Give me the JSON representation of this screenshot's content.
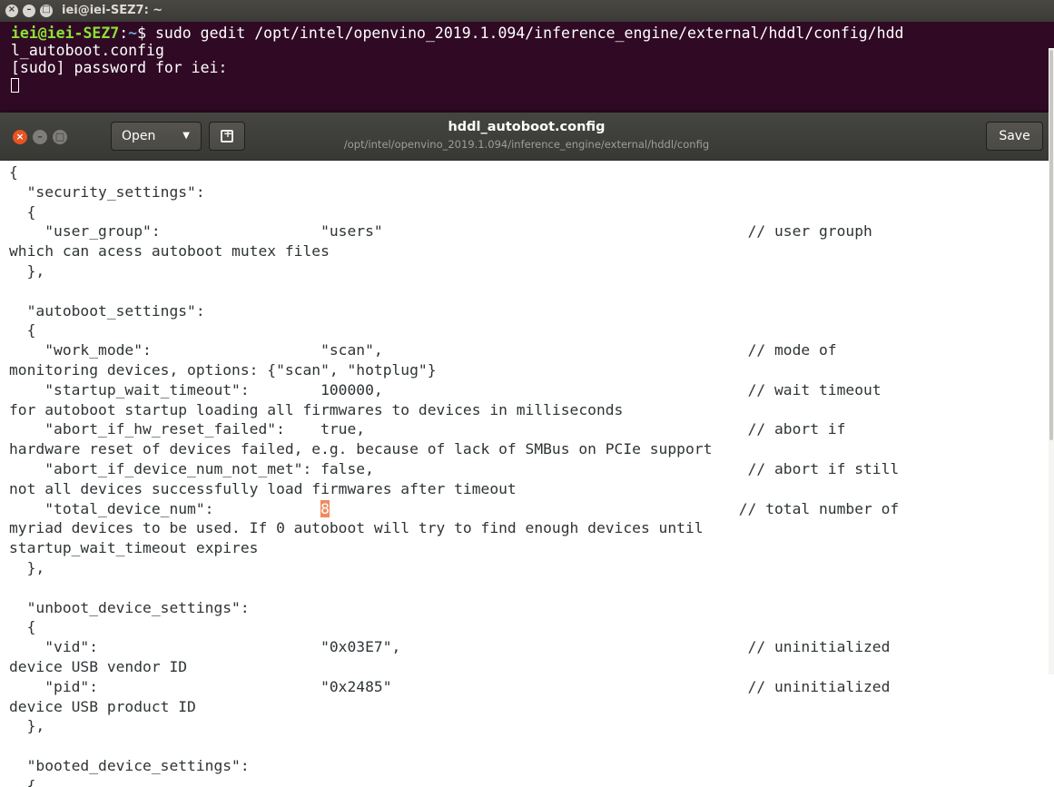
{
  "terminal": {
    "title": "iei@iei-SEZ7: ~",
    "prompt_user": "iei@iei-SEZ7",
    "prompt_sep": ":",
    "prompt_path": "~",
    "prompt_symbol": "$",
    "command_line1": " sudo gedit /opt/intel/openvino_2019.1.094/inference_engine/external/hddl/config/hdd",
    "command_line2": "l_autoboot.config",
    "sudo_prompt": "[sudo] password for iei:"
  },
  "gedit": {
    "open_label": "Open",
    "title": "hddl_autoboot.config",
    "subtitle": "/opt/intel/openvino_2019.1.094/inference_engine/external/hddl/config",
    "save_label": "Save",
    "lines": [
      "{",
      "  \"security_settings\":",
      "  {",
      "    \"user_group\":                  \"users\"                                         // user grouph",
      "which can acess autoboot mutex files",
      "  },",
      "",
      "  \"autoboot_settings\":",
      "  {",
      "    \"work_mode\":                   \"scan\",                                         // mode of",
      "monitoring devices, options: {\"scan\", \"hotplug\"}",
      "    \"startup_wait_timeout\":        100000,                                         // wait timeout",
      "for autoboot startup loading all firmwares to devices in milliseconds",
      "    \"abort_if_hw_reset_failed\":    true,                                           // abort if",
      "hardware reset of devices failed, e.g. because of lack of SMBus on PCIe support",
      "    \"abort_if_device_num_not_met\": false,                                          // abort if still",
      "not all devices successfully load firmwares after timeout",
      "    \"total_device_num\":            ",
      "myriad devices to be used. If 0 autoboot will try to find enough devices until",
      "startup_wait_timeout expires",
      "  },",
      "",
      "  \"unboot_device_settings\":",
      "  {",
      "    \"vid\":                         \"0x03E7\",                                       // uninitialized",
      "device USB vendor ID",
      "    \"pid\":                         \"0x2485\"                                        // uninitialized",
      "device USB product ID",
      "  },",
      "",
      "  \"booted_device_settings\":",
      "  {"
    ],
    "highlight_value": "8",
    "after_highlight": "                                              // total number of"
  }
}
